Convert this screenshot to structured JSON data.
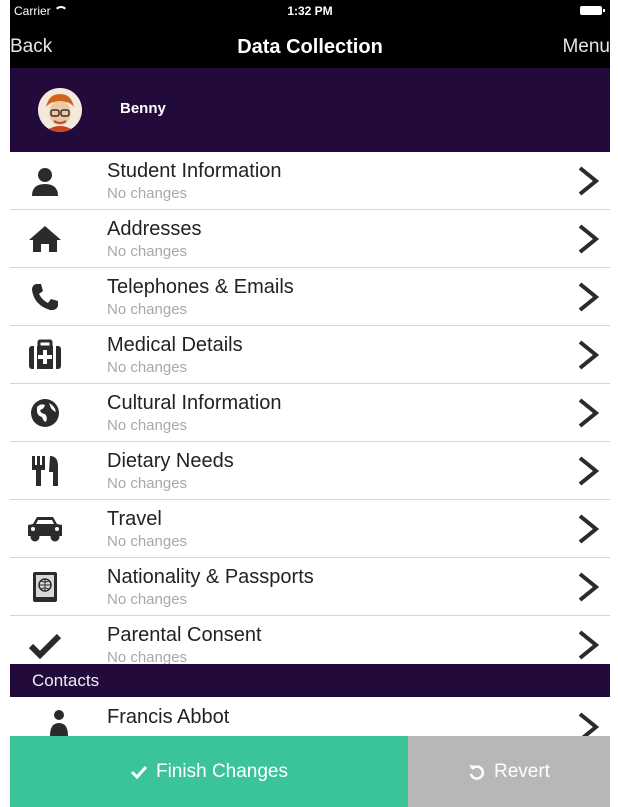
{
  "status_bar": {
    "carrier": "Carrier",
    "time": "1:32 PM"
  },
  "nav": {
    "back": "Back",
    "title": "Data Collection",
    "menu": "Menu"
  },
  "profile": {
    "name": "Benny"
  },
  "sections": [
    {
      "title": "Student Information",
      "subtitle": "No changes",
      "icon": "person-icon"
    },
    {
      "title": "Addresses",
      "subtitle": "No changes",
      "icon": "home-icon"
    },
    {
      "title": "Telephones & Emails",
      "subtitle": "No changes",
      "icon": "phone-icon"
    },
    {
      "title": "Medical Details",
      "subtitle": "No changes",
      "icon": "medical-kit-icon"
    },
    {
      "title": "Cultural Information",
      "subtitle": "No changes",
      "icon": "globe-icon"
    },
    {
      "title": "Dietary Needs",
      "subtitle": "No changes",
      "icon": "fork-knife-icon"
    },
    {
      "title": "Travel",
      "subtitle": "No changes",
      "icon": "car-icon"
    },
    {
      "title": "Nationality & Passports",
      "subtitle": "No changes",
      "icon": "passport-icon"
    },
    {
      "title": "Parental Consent",
      "subtitle": "No changes",
      "icon": "checkmark-icon"
    }
  ],
  "contacts_header": "Contacts",
  "contacts": [
    {
      "name": "Francis Abbot",
      "icon": "person-icon"
    }
  ],
  "footer": {
    "finish_label": "Finish Changes",
    "revert_label": "Revert"
  },
  "colors": {
    "header_purple": "#220b3a",
    "finish_green": "#3bc49a",
    "revert_gray": "#b7b7b7"
  }
}
